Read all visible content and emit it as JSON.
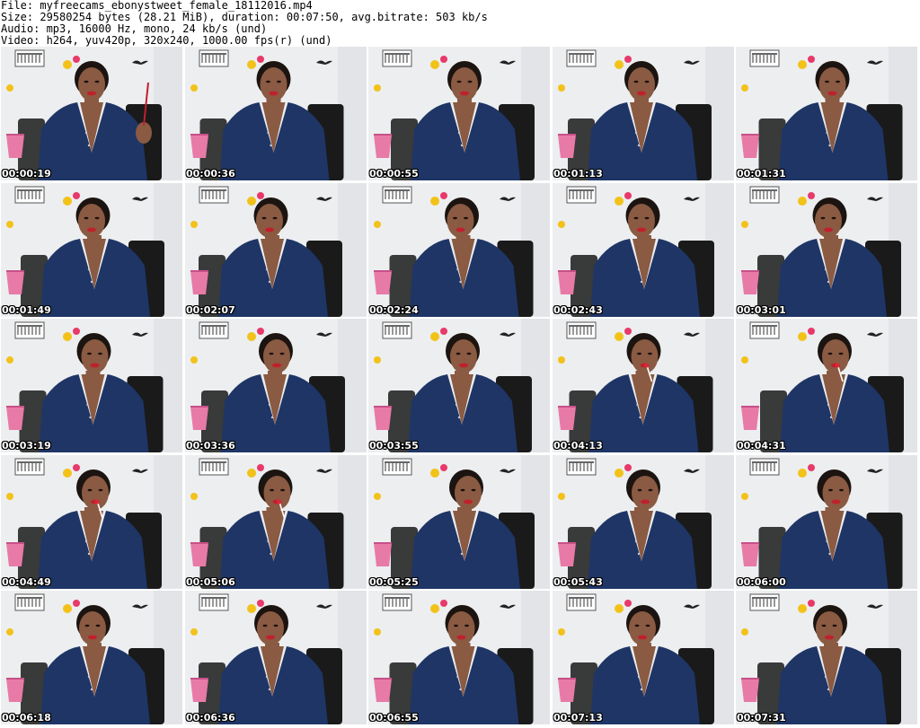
{
  "header": {
    "file": "File: myfreecams_ebonystweet_female_18112016.mp4",
    "size": "Size: 29580254 bytes (28.21 MiB), duration: 00:07:50, avg.bitrate: 503 kb/s",
    "audio": "Audio: mp3, 16000 Hz, mono, 24 kb/s (und)",
    "video": "Video: h264, yuv420p, 320x240, 1000.00 fps(r) (und)"
  },
  "colors": {
    "wall": "#eceef0",
    "blouse": "#1e3566",
    "skin": "#8a5a42",
    "hair": "#1c1410",
    "lips": "#c0202c",
    "chair": "#1a1a1a",
    "bin": "#e87aa8",
    "timestamp_text": "#ffffff",
    "timestamp_outline": "#000000"
  },
  "icons": {
    "frame_scene": "webcam-frame",
    "wall_sign": "colosseum-sign-icon",
    "bird": "bird-decal-icon",
    "emoji": "emoji-sticker-icon",
    "bin": "pink-bin-icon",
    "lollipop": "lollipop-icon"
  },
  "frames": [
    {
      "time": "00:00:19",
      "prop": "pen"
    },
    {
      "time": "00:00:36",
      "prop": ""
    },
    {
      "time": "00:00:55",
      "prop": ""
    },
    {
      "time": "00:01:13",
      "prop": ""
    },
    {
      "time": "00:01:31",
      "prop": ""
    },
    {
      "time": "00:01:49",
      "prop": ""
    },
    {
      "time": "00:02:07",
      "prop": ""
    },
    {
      "time": "00:02:24",
      "prop": ""
    },
    {
      "time": "00:02:43",
      "prop": ""
    },
    {
      "time": "00:03:01",
      "prop": ""
    },
    {
      "time": "00:03:19",
      "prop": ""
    },
    {
      "time": "00:03:36",
      "prop": ""
    },
    {
      "time": "00:03:55",
      "prop": ""
    },
    {
      "time": "00:04:13",
      "prop": "lollipop"
    },
    {
      "time": "00:04:31",
      "prop": "lollipop"
    },
    {
      "time": "00:04:49",
      "prop": "lollipop"
    },
    {
      "time": "00:05:06",
      "prop": "lollipop"
    },
    {
      "time": "00:05:25",
      "prop": ""
    },
    {
      "time": "00:05:43",
      "prop": ""
    },
    {
      "time": "00:06:00",
      "prop": ""
    },
    {
      "time": "00:06:18",
      "prop": ""
    },
    {
      "time": "00:06:36",
      "prop": ""
    },
    {
      "time": "00:06:55",
      "prop": ""
    },
    {
      "time": "00:07:13",
      "prop": ""
    },
    {
      "time": "00:07:31",
      "prop": ""
    }
  ]
}
